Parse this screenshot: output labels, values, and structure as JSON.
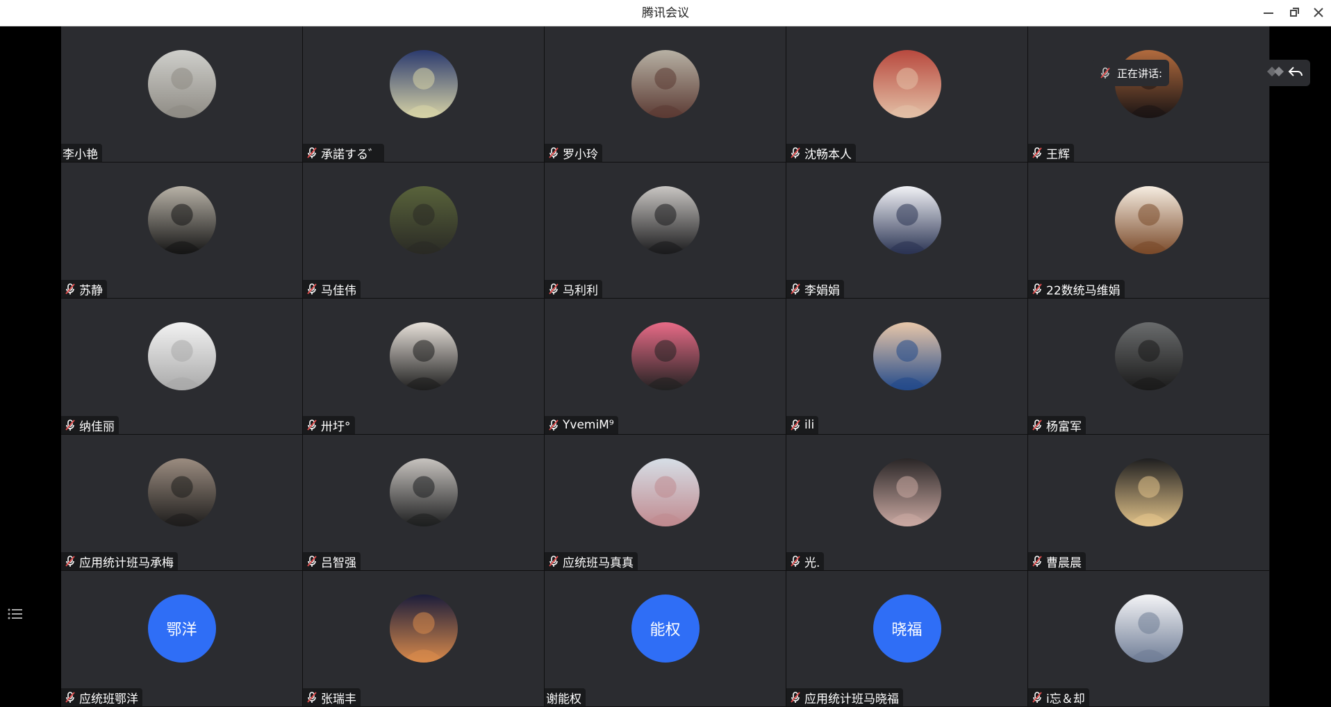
{
  "window": {
    "title": "腾讯会议"
  },
  "window_controls": {
    "minimize": "minimize-icon",
    "restore": "restore-icon",
    "close": "close-icon"
  },
  "speaking": {
    "label": "正在讲话:"
  },
  "colors": {
    "tile_bg": "#2b2c30",
    "text_avatar_bg": "#2f6ef6",
    "muted_mic": "#e34d4d"
  },
  "participants": [
    {
      "name": "李小艳",
      "muted": false,
      "avatar_kind": "photo",
      "tone": [
        "#cfcfcb",
        "#8e8b84"
      ]
    },
    {
      "name": "承諾する゛",
      "muted": true,
      "avatar_kind": "photo",
      "tone": [
        "#2b3a6e",
        "#d7d3a6"
      ]
    },
    {
      "name": "罗小玲",
      "muted": true,
      "avatar_kind": "photo",
      "tone": [
        "#b7b1a4",
        "#5b3a33"
      ]
    },
    {
      "name": "沈畅本人",
      "muted": true,
      "avatar_kind": "photo",
      "tone": [
        "#b8493e",
        "#e3c0a6"
      ]
    },
    {
      "name": "王辉",
      "muted": true,
      "avatar_kind": "photo",
      "tone": [
        "#b26b3e",
        "#1a1414"
      ]
    },
    {
      "name": "苏静",
      "muted": true,
      "avatar_kind": "photo",
      "tone": [
        "#b8b2a7",
        "#151515"
      ]
    },
    {
      "name": "马佳伟",
      "muted": true,
      "avatar_kind": "photo",
      "tone": [
        "#59633b",
        "#2a2a25"
      ]
    },
    {
      "name": "马利利",
      "muted": true,
      "avatar_kind": "photo",
      "tone": [
        "#c9c6c3",
        "#1b1b1d"
      ]
    },
    {
      "name": "李娟娟",
      "muted": true,
      "avatar_kind": "photo",
      "tone": [
        "#f1f2f6",
        "#2b3453"
      ]
    },
    {
      "name": "22数统马维娟",
      "muted": true,
      "avatar_kind": "photo",
      "tone": [
        "#f6ede1",
        "#7a4a2a"
      ]
    },
    {
      "name": "纳佳丽",
      "muted": true,
      "avatar_kind": "photo",
      "tone": [
        "#f2f2f2",
        "#a9a9a9"
      ]
    },
    {
      "name": "卅圩°",
      "muted": true,
      "avatar_kind": "photo",
      "tone": [
        "#e7e1da",
        "#1e1e1e"
      ]
    },
    {
      "name": "YvemiM⁹",
      "muted": true,
      "avatar_kind": "photo",
      "tone": [
        "#e86b87",
        "#222"
      ]
    },
    {
      "name": "ili",
      "muted": true,
      "avatar_kind": "photo",
      "tone": [
        "#e8c7a9",
        "#234a8a"
      ]
    },
    {
      "name": "杨富军",
      "muted": true,
      "avatar_kind": "photo",
      "tone": [
        "#6a6c6d",
        "#1a1a1a"
      ]
    },
    {
      "name": "应用统计班马承梅",
      "muted": true,
      "avatar_kind": "photo",
      "tone": [
        "#9b8c80",
        "#1e1d1c"
      ]
    },
    {
      "name": "吕智强",
      "muted": true,
      "avatar_kind": "photo",
      "tone": [
        "#c7c3bf",
        "#1e1f20"
      ]
    },
    {
      "name": "应统班马真真",
      "muted": true,
      "avatar_kind": "photo",
      "tone": [
        "#d6dee6",
        "#c08a8f"
      ]
    },
    {
      "name": "光.",
      "muted": true,
      "avatar_kind": "photo",
      "tone": [
        "#2a2627",
        "#caa9a2"
      ]
    },
    {
      "name": "曹晨晨",
      "muted": true,
      "avatar_kind": "photo",
      "tone": [
        "#1f1f20",
        "#e2c38a"
      ]
    },
    {
      "name": "应统班鄂洋",
      "muted": true,
      "avatar_kind": "text",
      "initials": "鄂洋"
    },
    {
      "name": "张瑞丰",
      "muted": true,
      "avatar_kind": "photo",
      "tone": [
        "#1b1d3b",
        "#d98a4b"
      ]
    },
    {
      "name": "谢能权",
      "muted": false,
      "avatar_kind": "text",
      "initials": "能权"
    },
    {
      "name": "应用统计班马晓福",
      "muted": true,
      "avatar_kind": "text",
      "initials": "晓福"
    },
    {
      "name": "i忘＆却",
      "muted": true,
      "avatar_kind": "photo",
      "tone": [
        "#f4f4f6",
        "#6f7d96"
      ]
    }
  ]
}
